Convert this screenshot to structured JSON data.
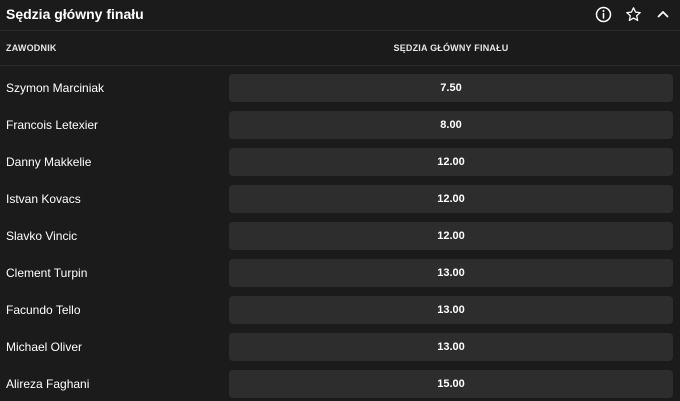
{
  "header": {
    "title": "Sędzia główny finału"
  },
  "columns": {
    "name": "ZAWODNIK",
    "market": "SĘDZIA GŁÓWNY FINAŁU"
  },
  "rows": [
    {
      "name": "Szymon Marciniak",
      "odds": "7.50"
    },
    {
      "name": "Francois Letexier",
      "odds": "8.00"
    },
    {
      "name": "Danny Makkelie",
      "odds": "12.00"
    },
    {
      "name": "Istvan Kovacs",
      "odds": "12.00"
    },
    {
      "name": "Slavko Vincic",
      "odds": "12.00"
    },
    {
      "name": "Clement Turpin",
      "odds": "13.00"
    },
    {
      "name": "Facundo Tello",
      "odds": "13.00"
    },
    {
      "name": "Michael Oliver",
      "odds": "13.00"
    },
    {
      "name": "Alireza Faghani",
      "odds": "15.00"
    }
  ]
}
